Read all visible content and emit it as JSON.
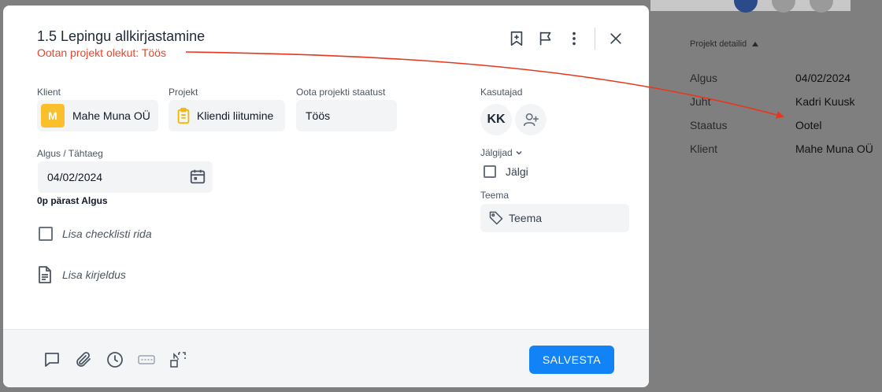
{
  "background": {
    "details_header": "Projekt detailid",
    "rows": [
      {
        "key": "Algus",
        "value": "04/02/2024"
      },
      {
        "key": "Juht",
        "value": "Kadri Kuusk"
      },
      {
        "key": "Staatus",
        "value": "Ootel"
      },
      {
        "key": "Klient",
        "value": "Mahe Muna OÜ"
      }
    ]
  },
  "modal": {
    "title": "1.5 Lepingu allkirjastamine",
    "subtitle": "Ootan projekt olekut: Töös",
    "fields": {
      "client_label": "Klient",
      "client_badge": "M",
      "client_value": "Mahe Muna OÜ",
      "project_label": "Projekt",
      "project_value": "Kliendi liitumine",
      "status_label": "Oota projekti staatust",
      "status_value": "Töös",
      "date_label": "Algus / Tähtaeg",
      "date_value": "04/02/2024",
      "date_offset": "0p pärast Algus"
    },
    "checklist_placeholder": "Lisa checklisti rida",
    "description_placeholder": "Lisa kirjeldus",
    "users_label": "Kasutajad",
    "user_initials": "KK",
    "followers_label": "Jälgijad",
    "follow_label": "Jälgi",
    "theme_label": "Teema",
    "theme_placeholder": "Teema",
    "save_label": "SALVESTA"
  },
  "colors": {
    "accent": "#1183f7",
    "subtitle": "#e8452c",
    "client_badge": "#f9bf2c",
    "project_icon": "#f2b705",
    "arrow": "#e8361c"
  },
  "icons": {
    "header": [
      "bookmark-plus-icon",
      "flag-icon",
      "more-vertical-icon",
      "close-icon"
    ],
    "footer": [
      "comment-icon",
      "attachment-icon",
      "clock-icon",
      "keyboard-icon",
      "convert-icon"
    ]
  }
}
